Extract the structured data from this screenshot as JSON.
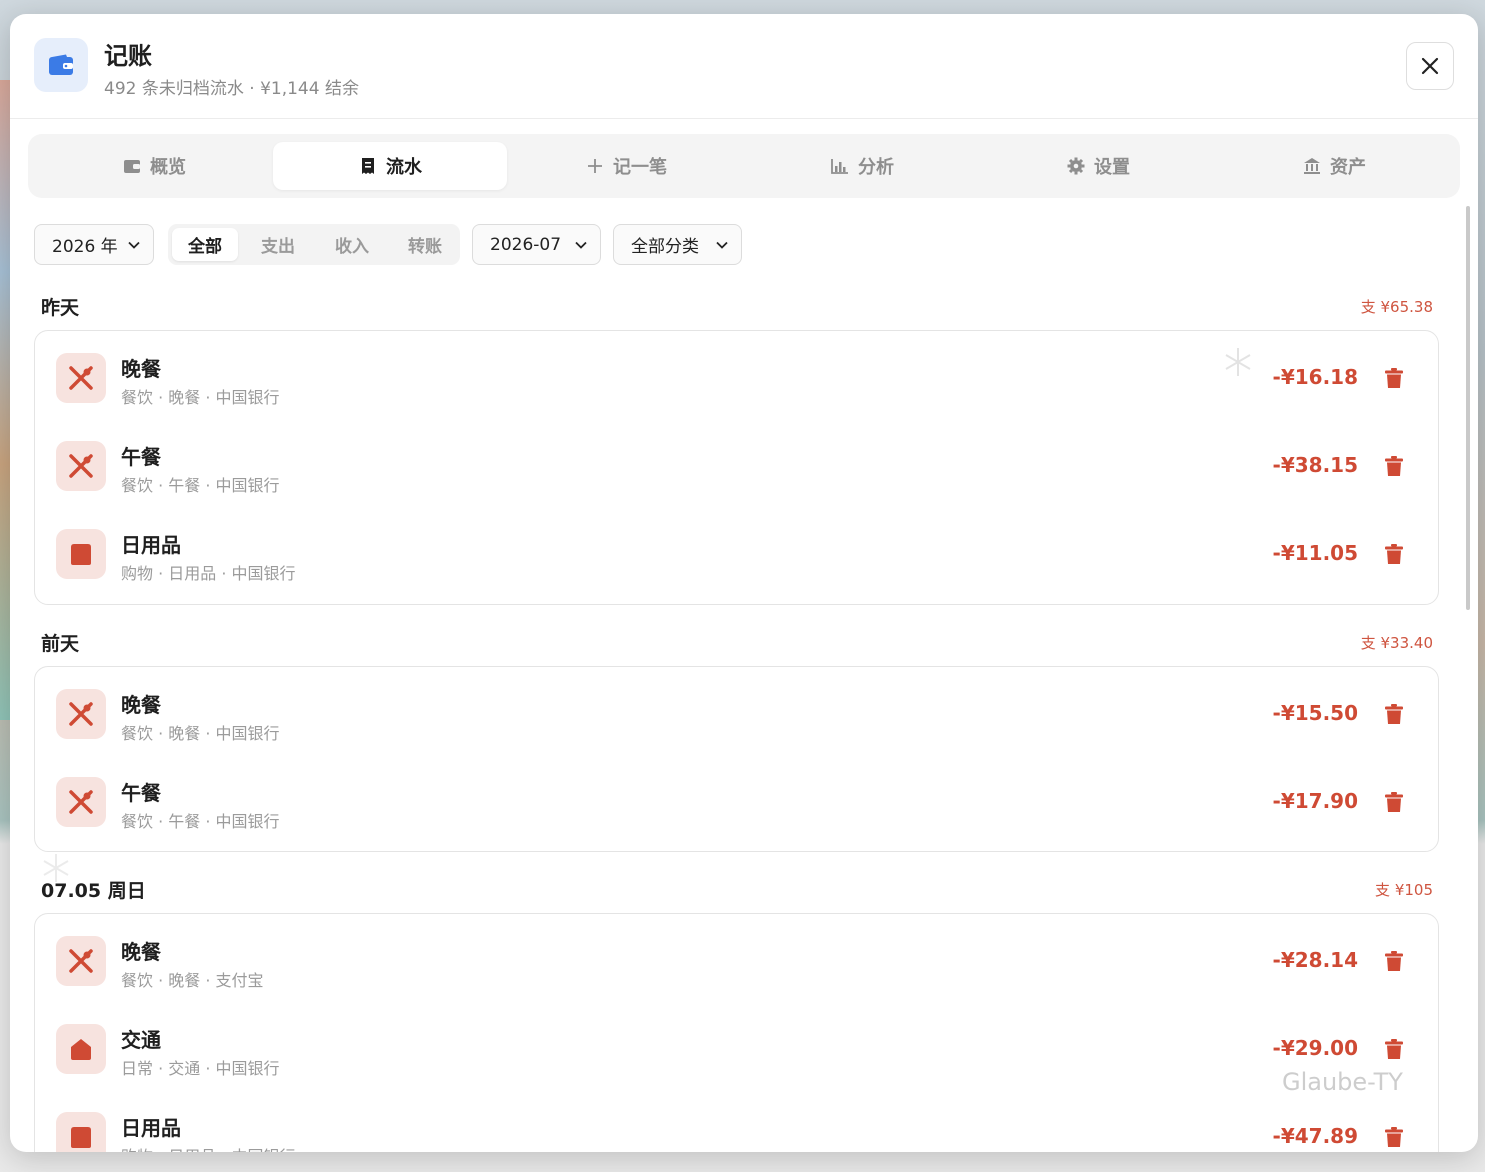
{
  "header": {
    "title": "记账",
    "subtitle": "492 条未归档流水 · ¥1,144 结余",
    "close_icon": "close-icon",
    "app_icon": "wallet-icon"
  },
  "tabs": [
    {
      "label": "概览",
      "icon": "wallet-icon",
      "active": false
    },
    {
      "label": "流水",
      "icon": "receipt-icon",
      "active": true
    },
    {
      "label": "记一笔",
      "icon": "plus-icon",
      "active": false
    },
    {
      "label": "分析",
      "icon": "chart-icon",
      "active": false
    },
    {
      "label": "设置",
      "icon": "gear-icon",
      "active": false
    },
    {
      "label": "资产",
      "icon": "bank-icon",
      "active": false
    }
  ],
  "filters": {
    "year": "2026 年",
    "type_segments": [
      "全部",
      "支出",
      "收入",
      "转账"
    ],
    "type_selected": "全部",
    "month": "2026-07",
    "category": "全部分类"
  },
  "colors": {
    "accent": "#3b7be6",
    "expense": "#cf4a34",
    "icon_bg": "#f7e3df"
  },
  "days": [
    {
      "title": "昨天",
      "total": "支 ¥65.38",
      "rows": [
        {
          "title": "晚餐",
          "meta": "餐饮 · 晚餐 · 中国银行",
          "amount": "-¥16.18",
          "icon": "dining-icon"
        },
        {
          "title": "午餐",
          "meta": "餐饮 · 午餐 · 中国银行",
          "amount": "-¥38.15",
          "icon": "dining-icon"
        },
        {
          "title": "日用品",
          "meta": "购物 · 日用品 · 中国银行",
          "amount": "-¥11.05",
          "icon": "shopping-bag-icon"
        }
      ]
    },
    {
      "title": "前天",
      "total": "支 ¥33.40",
      "rows": [
        {
          "title": "晚餐",
          "meta": "餐饮 · 晚餐 · 中国银行",
          "amount": "-¥15.50",
          "icon": "dining-icon"
        },
        {
          "title": "午餐",
          "meta": "餐饮 · 午餐 · 中国银行",
          "amount": "-¥17.90",
          "icon": "dining-icon"
        }
      ]
    },
    {
      "title": "07.05 周日",
      "total": "支 ¥105",
      "rows": [
        {
          "title": "晚餐",
          "meta": "餐饮 · 晚餐 · 支付宝",
          "amount": "-¥28.14",
          "icon": "dining-icon"
        },
        {
          "title": "交通",
          "meta": "日常 · 交通 · 中国银行",
          "amount": "-¥29.00",
          "icon": "home-icon"
        },
        {
          "title": "日用品",
          "meta": "购物 · 日用品 · 中国银行",
          "amount": "-¥47.89",
          "icon": "shopping-bag-icon"
        }
      ]
    }
  ],
  "watermark": "Glaube-TY"
}
